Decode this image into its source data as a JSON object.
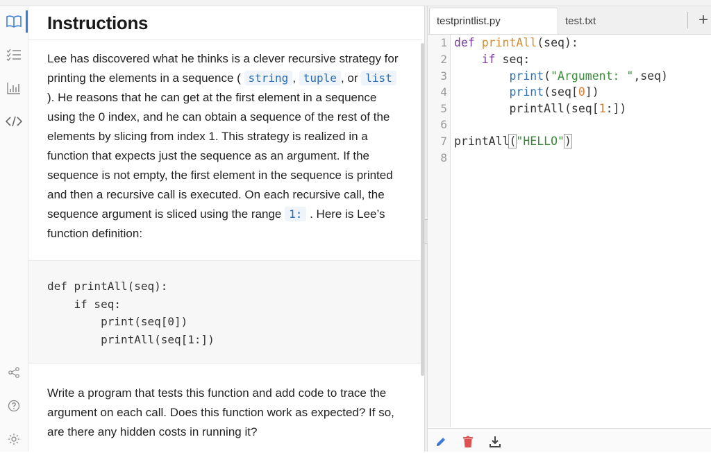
{
  "rail": {
    "icons": [
      "book-icon",
      "checklist-icon",
      "chart-icon",
      "code-icon",
      "share-icon",
      "help-icon",
      "settings-icon"
    ],
    "active": "book-icon",
    "accent_color": "#3d7bd9"
  },
  "instructions": {
    "title": "Instructions",
    "p1": {
      "t1": "Lee has discovered what he thinks is a clever recursive strategy for printing the elements in a sequence ( ",
      "c1": "string",
      "t2": ", ",
      "c2": "tuple",
      "t3": ", or ",
      "c3": "list",
      "t4": " ). He reasons that he can get at the first element in a sequence using the 0 index, and he can obtain a sequence of the rest of the elements by slicing from index 1. This strategy is realized in a function that expects just the sequence as an argument. If the sequence is not empty, the first element in the sequence is printed and then a recursive call is executed. On each recursive call, the sequence argument is sliced using the range ",
      "c4": "1:",
      "t5": " . Here is Lee’s function definition:"
    },
    "code_lines": [
      "def printAll(seq):",
      "    if seq:",
      "        print(seq[0])",
      "        printAll(seq[1:])"
    ],
    "p2": "Write a program that tests this function and add code to trace the argument on each call. Does this function work as expected? If so, are there any hidden costs in running it?"
  },
  "editor": {
    "tabs": [
      "testprintlist.py",
      "test.txt"
    ],
    "active_tab": "testprintlist.py",
    "add_tab_label": "+",
    "line_numbers": [
      "1",
      "2",
      "3",
      "4",
      "5",
      "6",
      "7",
      "8"
    ],
    "code": {
      "l1": {
        "kw": "def",
        "fn": "printAll",
        "rest": "(seq):"
      },
      "l2": {
        "indent": "    ",
        "kw": "if",
        "rest": " seq:"
      },
      "l3": {
        "indent": "        ",
        "bi": "print",
        "open": "(",
        "str": "\"Argument: \"",
        "rest": ",seq)"
      },
      "l4": {
        "indent": "        ",
        "bi": "print",
        "a": "(seq[",
        "num": "0",
        "b": "])"
      },
      "l5": {
        "indent": "        ",
        "a": "printAll(seq[",
        "num": "1",
        "b": ":])"
      },
      "l7": {
        "a": "printAll",
        "open": "(",
        "str": "\"HELLO\"",
        "close": ")"
      }
    },
    "toolbar": [
      "pencil-icon",
      "trash-icon",
      "download-icon"
    ]
  }
}
